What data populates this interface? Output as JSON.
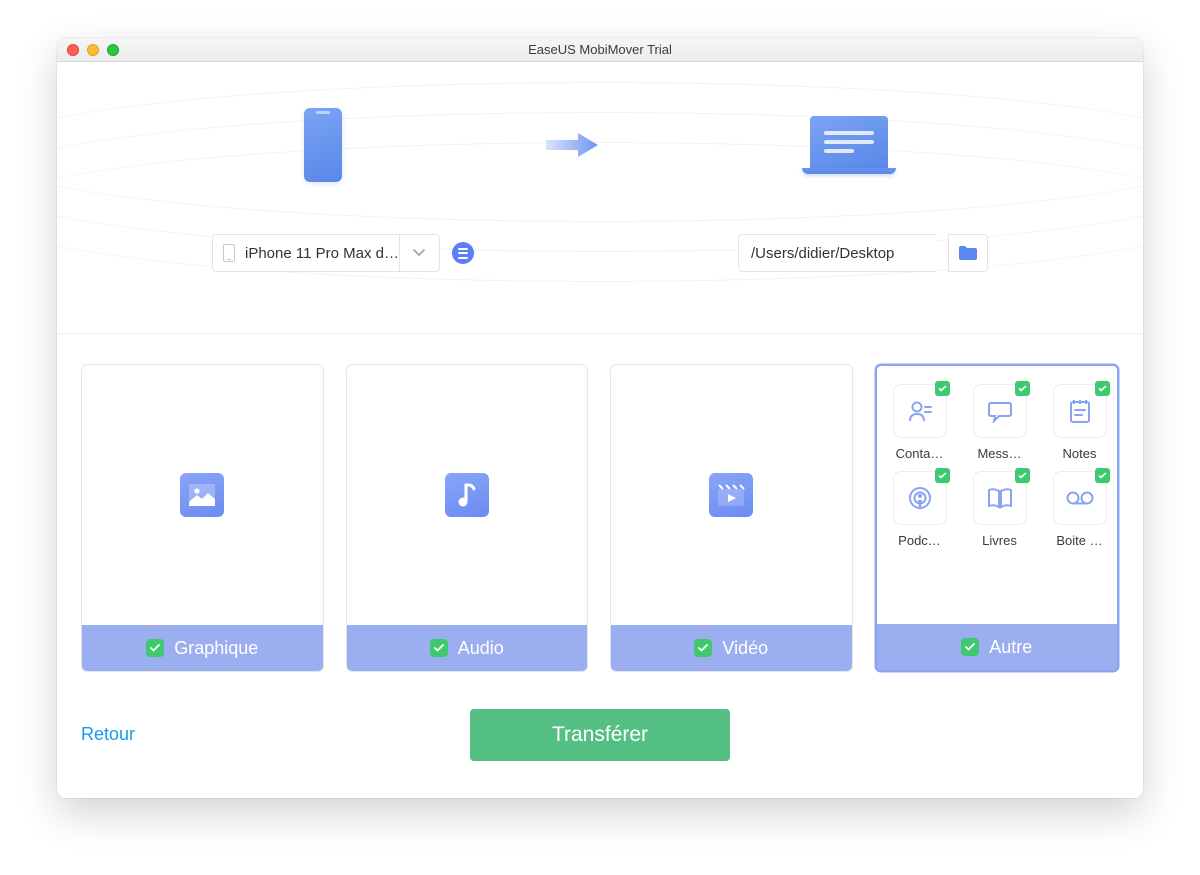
{
  "window_title": "EaseUS MobiMover Trial",
  "source": {
    "device_label": "iPhone 11 Pro Max d…"
  },
  "destination": {
    "path": "/Users/didier/Desktop"
  },
  "categories": [
    {
      "label": "Graphique",
      "checked": true
    },
    {
      "label": "Audio",
      "checked": true
    },
    {
      "label": "Vidéo",
      "checked": true
    },
    {
      "label": "Autre",
      "checked": true
    }
  ],
  "autre_items": [
    {
      "label": "Conta…",
      "icon": "contact"
    },
    {
      "label": "Mess…",
      "icon": "message"
    },
    {
      "label": "Notes",
      "icon": "notes"
    },
    {
      "label": "Podc…",
      "icon": "podcast"
    },
    {
      "label": "Livres",
      "icon": "book"
    },
    {
      "label": "Boite …",
      "icon": "voicemail"
    }
  ],
  "actions": {
    "back": "Retour",
    "transfer": "Transférer"
  }
}
